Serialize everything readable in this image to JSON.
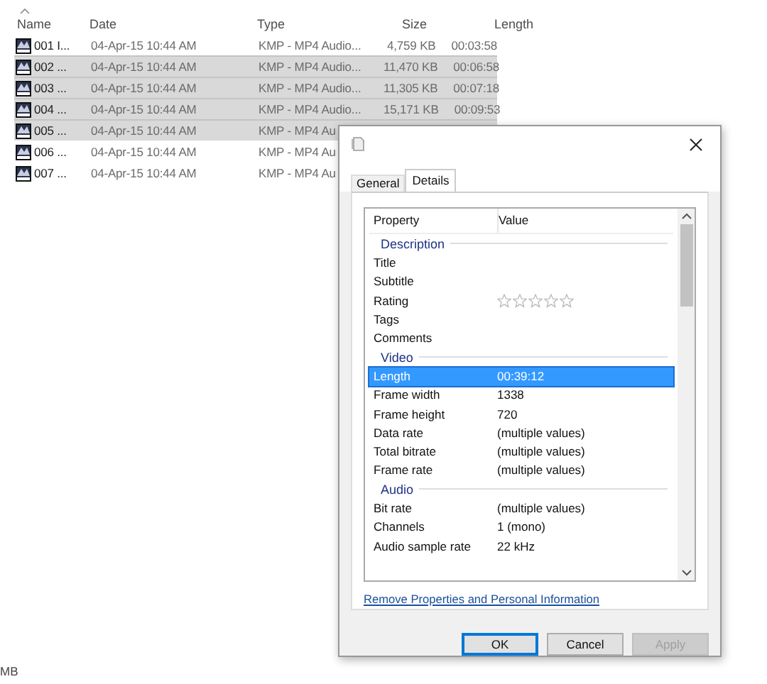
{
  "file_list": {
    "columns": [
      {
        "label": "Name",
        "sorted": true
      },
      {
        "label": "Date",
        "sorted": false
      },
      {
        "label": "Type",
        "sorted": false
      },
      {
        "label": "Size",
        "sorted": false
      },
      {
        "label": "Length",
        "sorted": false
      }
    ],
    "rows": [
      {
        "name": "001 I...",
        "date": "04-Apr-15 10:44 AM",
        "type": "KMP - MP4 Audio...",
        "size": "4,759 KB",
        "length": "00:03:58",
        "selected": false
      },
      {
        "name": "002 ...",
        "date": "04-Apr-15 10:44 AM",
        "type": "KMP - MP4 Audio...",
        "size": "11,470 KB",
        "length": "00:06:58",
        "selected": true
      },
      {
        "name": "003 ...",
        "date": "04-Apr-15 10:44 AM",
        "type": "KMP - MP4 Audio...",
        "size": "11,305 KB",
        "length": "00:07:18",
        "selected": true
      },
      {
        "name": "004 ...",
        "date": "04-Apr-15 10:44 AM",
        "type": "KMP - MP4 Audio...",
        "size": "15,171 KB",
        "length": "00:09:53",
        "selected": true
      },
      {
        "name": "005 ...",
        "date": "04-Apr-15 10:44 AM",
        "type": "KMP - MP4 Au",
        "selected": true
      },
      {
        "name": "006 ...",
        "date": "04-Apr-15 10:44 AM",
        "type": "KMP - MP4 Au",
        "selected": false
      },
      {
        "name": "007 ...",
        "date": "04-Apr-15 10:44 AM",
        "type": "KMP - MP4 Au",
        "selected": false
      }
    ]
  },
  "dialog": {
    "tabs": [
      {
        "label": "General",
        "selected": false
      },
      {
        "label": "Details",
        "selected": true
      }
    ],
    "columns": [
      "Property",
      "Value"
    ],
    "sections": [
      {
        "heading": "Description",
        "rows": [
          {
            "property": "Title",
            "kind": "text",
            "selected": false
          },
          {
            "property": "Subtitle",
            "kind": "text",
            "selected": false
          },
          {
            "property": "Rating",
            "kind": "stars",
            "stars": 0,
            "selected": false
          },
          {
            "property": "Tags",
            "kind": "text",
            "selected": false
          },
          {
            "property": "Comments",
            "kind": "text",
            "selected": false
          }
        ]
      },
      {
        "heading": "Video",
        "rows": [
          {
            "property": "Length",
            "value": "00:39:12",
            "kind": "text",
            "selected": true
          },
          {
            "property": "Frame width",
            "value": "1338",
            "kind": "text",
            "selected": false
          },
          {
            "property": "Frame height",
            "value": "720",
            "kind": "text",
            "selected": false
          },
          {
            "property": "Data rate",
            "value": "(multiple values)",
            "kind": "text",
            "selected": false
          },
          {
            "property": "Total bitrate",
            "value": "(multiple values)",
            "kind": "text",
            "selected": false
          },
          {
            "property": "Frame rate",
            "value": "(multiple values)",
            "kind": "text",
            "selected": false
          }
        ]
      },
      {
        "heading": "Audio",
        "rows": [
          {
            "property": "Bit rate",
            "value": "(multiple values)",
            "kind": "text",
            "selected": false
          },
          {
            "property": "Channels",
            "value": "1 (mono)",
            "kind": "text",
            "selected": false
          },
          {
            "property": "Audio sample rate",
            "value": "22 kHz",
            "kind": "text",
            "selected": false
          }
        ]
      }
    ],
    "link": "Remove Properties and Personal Information",
    "buttons": [
      {
        "label": "OK",
        "kind": "default"
      },
      {
        "label": "Cancel",
        "kind": "normal"
      },
      {
        "label": "Apply",
        "kind": "disabled"
      }
    ]
  },
  "status_bar": {
    "text": "MB"
  }
}
